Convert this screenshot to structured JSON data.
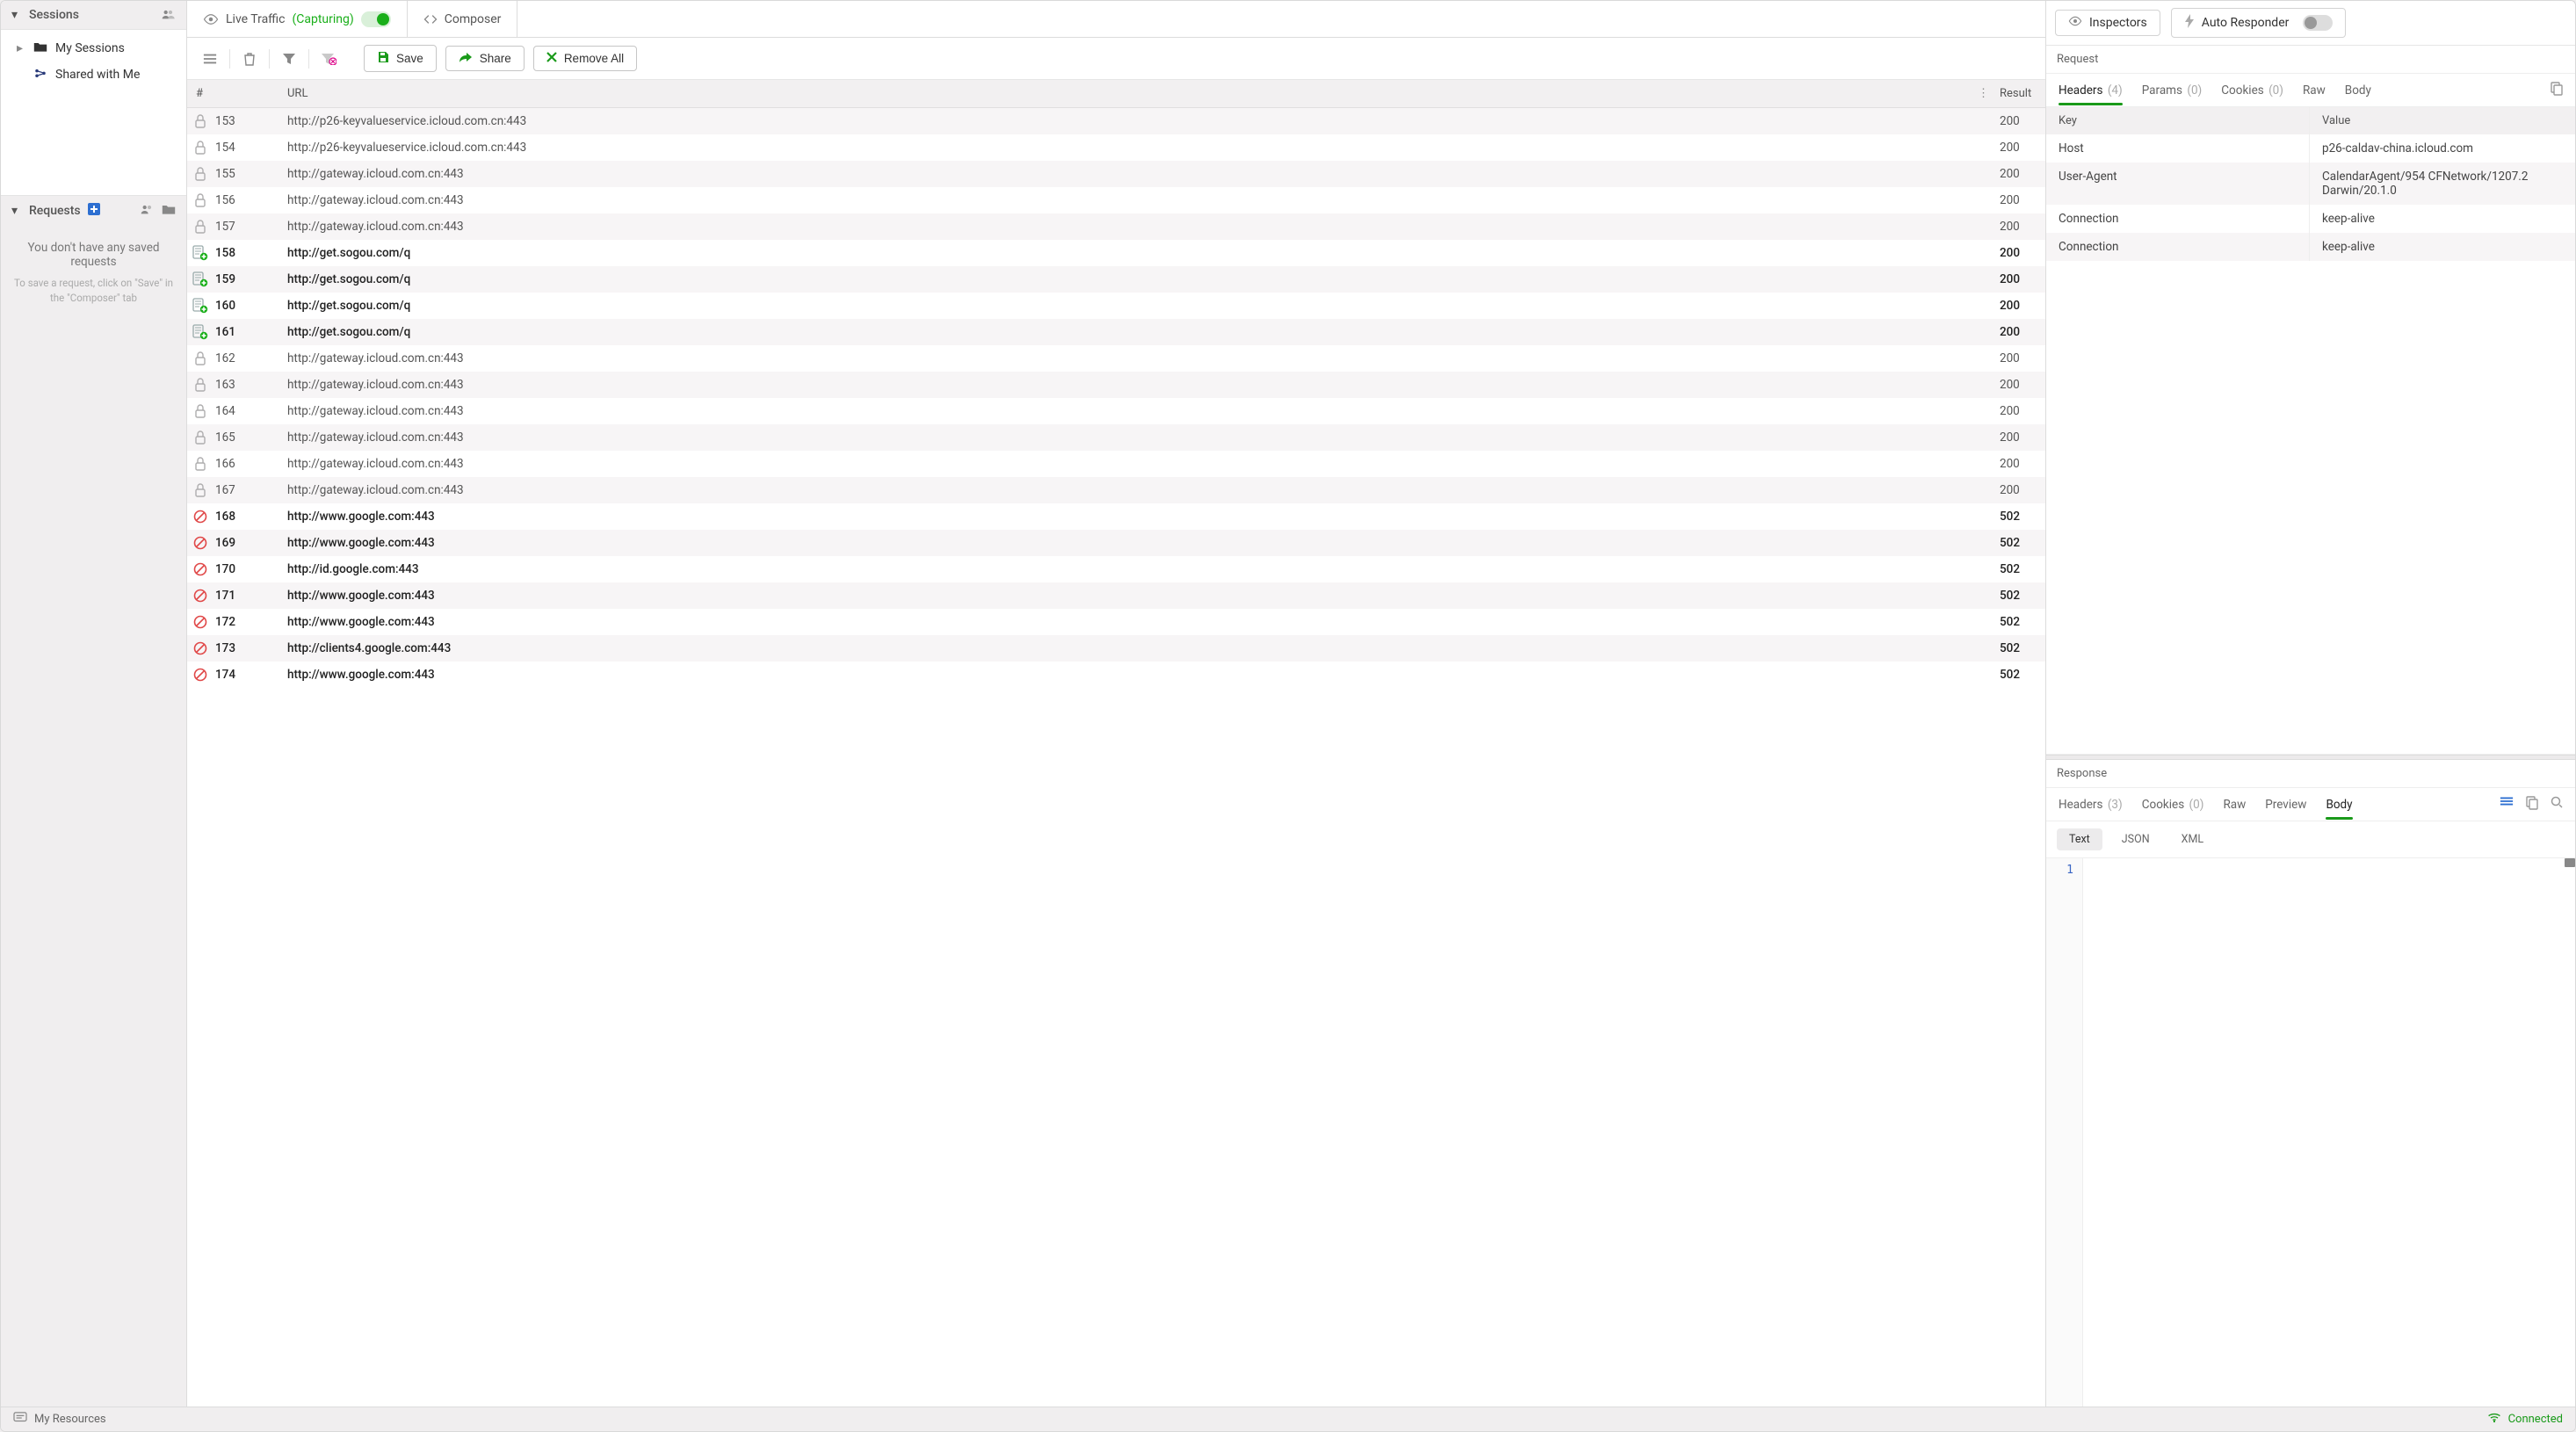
{
  "sidebar": {
    "sessions": {
      "title": "Sessions",
      "items": [
        {
          "icon": "folder",
          "label": "My Sessions"
        },
        {
          "icon": "share",
          "label": "Shared with Me"
        }
      ]
    },
    "requests": {
      "title": "Requests",
      "empty_msg": "You don't have any saved requests",
      "empty_hint": "To save a request, click on \"Save\" in the \"Composer\" tab"
    }
  },
  "tabs": {
    "live": {
      "label": "Live Traffic",
      "status": "(Capturing)"
    },
    "composer": {
      "label": "Composer"
    }
  },
  "toolbar": {
    "save": "Save",
    "share": "Share",
    "remove_all": "Remove All"
  },
  "grid": {
    "header": {
      "hash": "#",
      "url": "URL",
      "result": "Result"
    },
    "rows": [
      {
        "icon": "lock",
        "num": "153",
        "url": "http://p26-keyvalueservice.icloud.com.cn:443",
        "result": "200",
        "dim": true
      },
      {
        "icon": "lock",
        "num": "154",
        "url": "http://p26-keyvalueservice.icloud.com.cn:443",
        "result": "200",
        "dim": true
      },
      {
        "icon": "lock",
        "num": "155",
        "url": "http://gateway.icloud.com.cn:443",
        "result": "200",
        "dim": true
      },
      {
        "icon": "lock",
        "num": "156",
        "url": "http://gateway.icloud.com.cn:443",
        "result": "200",
        "dim": true
      },
      {
        "icon": "lock",
        "num": "157",
        "url": "http://gateway.icloud.com.cn:443",
        "result": "200",
        "dim": true
      },
      {
        "icon": "green",
        "num": "158",
        "url": "http://get.sogou.com/q",
        "result": "200",
        "dim": false
      },
      {
        "icon": "green",
        "num": "159",
        "url": "http://get.sogou.com/q",
        "result": "200",
        "dim": false
      },
      {
        "icon": "green",
        "num": "160",
        "url": "http://get.sogou.com/q",
        "result": "200",
        "dim": false
      },
      {
        "icon": "green",
        "num": "161",
        "url": "http://get.sogou.com/q",
        "result": "200",
        "dim": false
      },
      {
        "icon": "lock",
        "num": "162",
        "url": "http://gateway.icloud.com.cn:443",
        "result": "200",
        "dim": true
      },
      {
        "icon": "lock",
        "num": "163",
        "url": "http://gateway.icloud.com.cn:443",
        "result": "200",
        "dim": true
      },
      {
        "icon": "lock",
        "num": "164",
        "url": "http://gateway.icloud.com.cn:443",
        "result": "200",
        "dim": true
      },
      {
        "icon": "lock",
        "num": "165",
        "url": "http://gateway.icloud.com.cn:443",
        "result": "200",
        "dim": true
      },
      {
        "icon": "lock",
        "num": "166",
        "url": "http://gateway.icloud.com.cn:443",
        "result": "200",
        "dim": true
      },
      {
        "icon": "lock",
        "num": "167",
        "url": "http://gateway.icloud.com.cn:443",
        "result": "200",
        "dim": true
      },
      {
        "icon": "forbid",
        "num": "168",
        "url": "http://www.google.com:443",
        "result": "502",
        "dim": false
      },
      {
        "icon": "forbid",
        "num": "169",
        "url": "http://www.google.com:443",
        "result": "502",
        "dim": false
      },
      {
        "icon": "forbid",
        "num": "170",
        "url": "http://id.google.com:443",
        "result": "502",
        "dim": false
      },
      {
        "icon": "forbid",
        "num": "171",
        "url": "http://www.google.com:443",
        "result": "502",
        "dim": false
      },
      {
        "icon": "forbid",
        "num": "172",
        "url": "http://www.google.com:443",
        "result": "502",
        "dim": false
      },
      {
        "icon": "forbid",
        "num": "173",
        "url": "http://clients4.google.com:443",
        "result": "502",
        "dim": false
      },
      {
        "icon": "forbid",
        "num": "174",
        "url": "http://www.google.com:443",
        "result": "502",
        "dim": false
      }
    ]
  },
  "inspector": {
    "tabs": {
      "inspectors": "Inspectors",
      "auto_responder": "Auto Responder"
    },
    "request": {
      "title": "Request",
      "subtabs": {
        "headers": {
          "label": "Headers",
          "count": "(4)"
        },
        "params": {
          "label": "Params",
          "count": "(0)"
        },
        "cookies": {
          "label": "Cookies",
          "count": "(0)"
        },
        "raw": {
          "label": "Raw"
        },
        "body": {
          "label": "Body"
        }
      },
      "kv_header": {
        "key": "Key",
        "value": "Value"
      },
      "kv": [
        {
          "k": "Host",
          "v": "p26-caldav-china.icloud.com"
        },
        {
          "k": "User-Agent",
          "v": "CalendarAgent/954 CFNetwork/1207.2 Darwin/20.1.0"
        },
        {
          "k": "Connection",
          "v": "keep-alive"
        },
        {
          "k": "Connection",
          "v": "keep-alive"
        }
      ]
    },
    "response": {
      "title": "Response",
      "subtabs": {
        "headers": {
          "label": "Headers",
          "count": "(3)"
        },
        "cookies": {
          "label": "Cookies",
          "count": "(0)"
        },
        "raw": {
          "label": "Raw"
        },
        "preview": {
          "label": "Preview"
        },
        "body": {
          "label": "Body"
        }
      },
      "formats": {
        "text": "Text",
        "json": "JSON",
        "xml": "XML"
      },
      "gutter_line": "1"
    }
  },
  "statusbar": {
    "resources": "My Resources",
    "connected": "Connected"
  }
}
